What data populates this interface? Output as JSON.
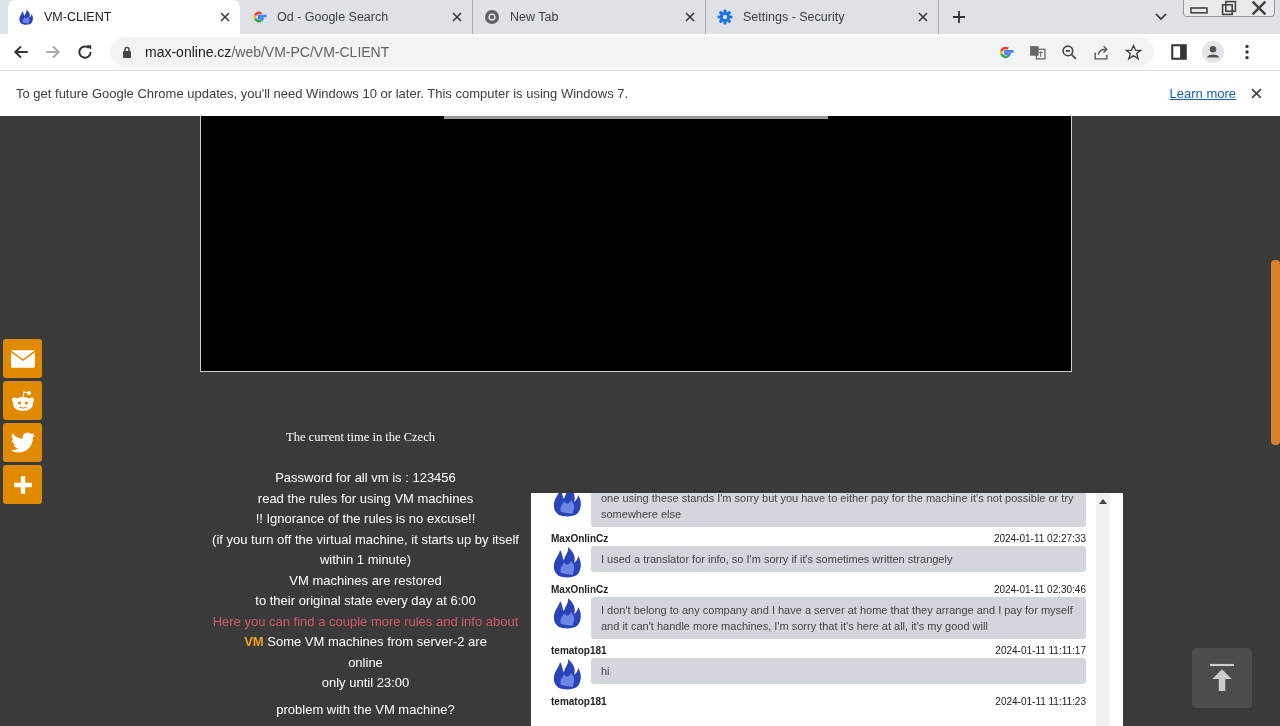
{
  "tabs": [
    {
      "title": "VM-CLIENT",
      "selected": true
    },
    {
      "title": "Od - Google Search",
      "selected": false
    },
    {
      "title": "New Tab",
      "selected": false
    },
    {
      "title": "Settings - Security",
      "selected": false
    }
  ],
  "address": {
    "host": "max-online.cz",
    "path": "/web/VM-PC/VM-CLIENT"
  },
  "infobar": {
    "message": "To get future Google Chrome updates, you'll need Windows 10 or later. This computer is using Windows 7.",
    "link": "Learn more"
  },
  "page": {
    "clock_text": "The current time in the Czech",
    "info_lines": [
      {
        "kind": "text",
        "text": "Password for all vm is : 123456"
      },
      {
        "kind": "text",
        "text": "read the rules for using VM machines"
      },
      {
        "kind": "text",
        "text": "!! Ignorance of the rules is no excuse!!"
      },
      {
        "kind": "text",
        "text": "(if you turn off the virtual machine, it starts up by itself within 1 minute)"
      },
      {
        "kind": "text",
        "text": "VM machines are restored"
      },
      {
        "kind": "text",
        "text": "to their original state every day at 6:00"
      },
      {
        "kind": "link",
        "text": "Here you can find a couple more rules and info about"
      },
      {
        "kind": "highlight",
        "highlight": "VM",
        "text": "Some VM machines from server-2 are"
      },
      {
        "kind": "text",
        "text": "online"
      },
      {
        "kind": "text",
        "text": "only until 23:00"
      },
      {
        "kind": "question",
        "text": "problem with the VM machine?"
      }
    ],
    "chat": [
      {
        "text": "one using these stands I'm sorry but you have to either pay for the machine it's not possible or try somewhere else"
      },
      {
        "user": "MaxOnlinCz",
        "time": "2024-01-11 02:27:33",
        "text": "I used a translator for info, so I'm sorry if it's sometimes written strangely"
      },
      {
        "user": "MaxOnlinCz",
        "time": "2024-01-11 02:30:46",
        "text": "I don't belong to any company and I have a server at home that they arrange and I pay for myself and it can't handle more machines, I'm sorry that it's here at all, it's my good will"
      },
      {
        "user": "tematop181",
        "time": "2024-01-11 11:11:17",
        "text": "hi"
      },
      {
        "user": "tematop181",
        "time": "2024-01-11 11:11:23"
      }
    ]
  }
}
